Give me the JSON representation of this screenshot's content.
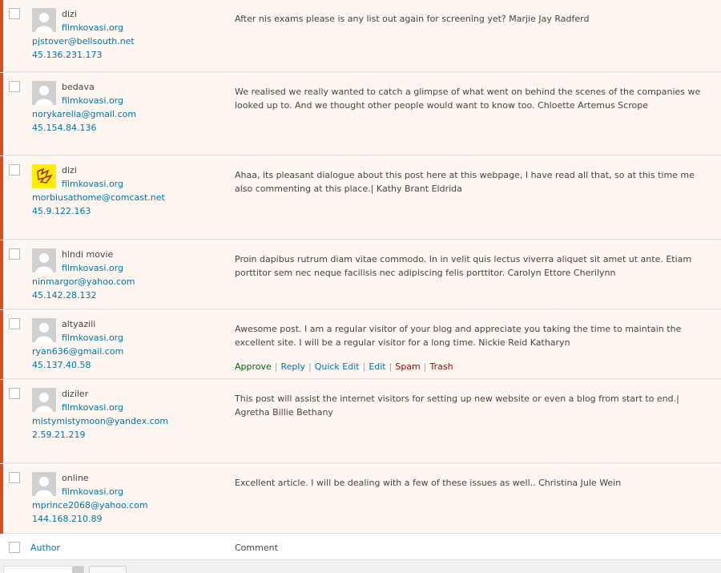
{
  "colors": {
    "row_background": "#fef7f1",
    "unapproved_border": "#d54e21",
    "link": "#0073aa",
    "approve": "#006505",
    "danger": "#a00"
  },
  "comments": [
    {
      "author": "dizi",
      "url": "filmkovasi.org",
      "email": "pjstover@bellsouth.net",
      "ip": "45.136.231.173",
      "text": "After nis exams please is any list out again for screening yet? Marjie Jay Radferd",
      "avatar": "default-avatar-icon"
    },
    {
      "author": "bedava",
      "url": "filmkovasi.org",
      "email": "norykarelia@gmail.com",
      "ip": "45.154.84.136",
      "text": "We realised we really wanted to catch a glimpse of what went on behind the scenes of the companies we looked up to. And we thought other people would want to know too. Chloette Artemus Scrope",
      "avatar": "default-avatar-icon"
    },
    {
      "author": "dizi",
      "url": "filmkovasi.org",
      "email": "morbiusathome@comcast.net",
      "ip": "45.9.122.163",
      "text": "Ahaa, its pleasant dialogue about this post here at this webpage, I have read all that, so at this time me also commenting at this place.| Kathy Brant Eldrida",
      "avatar": "custom-yellow-avatar-icon"
    },
    {
      "author": "hindi movie",
      "url": "filmkovasi.org",
      "email": "ninmargor@yahoo.com",
      "ip": "45.142.28.132",
      "text": "Proin dapibus rutrum diam vitae commodo. In in velit quis lectus viverra aliquet sit amet ut ante. Etiam porttitor sem nec neque facilisis nec adipiscing felis porttitor. Carolyn Ettore Cherilynn",
      "avatar": "default-avatar-icon"
    },
    {
      "author": "altyazili",
      "url": "filmkovasi.org",
      "email": "ryan636@gmail.com",
      "ip": "45.137.40.58",
      "text": "Awesome post. I am a regular visitor of your blog and appreciate you taking the time to maintain the excellent site. I will be a regular visitor for a long time. Nickie Reid Katharyn",
      "avatar": "default-avatar-icon"
    },
    {
      "author": "diziler",
      "url": "filmkovasi.org",
      "email": "mistymistymoon@yandex.com",
      "ip": "2.59.21.219",
      "text": "This post will assist the internet visitors for setting up new website or even a blog from start to end.| Agretha Billie Bethany",
      "avatar": "default-avatar-icon"
    },
    {
      "author": "online",
      "url": "filmkovasi.org",
      "email": "mprince2068@yahoo.com",
      "ip": "144.168.210.89",
      "text": "Excellent article. I will be dealing with a few of these issues as well.. Christina Jule Wein",
      "avatar": "default-avatar-icon"
    }
  ],
  "row_actions": {
    "approve": "Approve",
    "reply": "Reply",
    "quick_edit": "Quick Edit",
    "edit": "Edit",
    "spam": "Spam",
    "trash": "Trash",
    "separator": "|"
  },
  "footer": {
    "author_col": "Author",
    "comment_col": "Comment"
  }
}
